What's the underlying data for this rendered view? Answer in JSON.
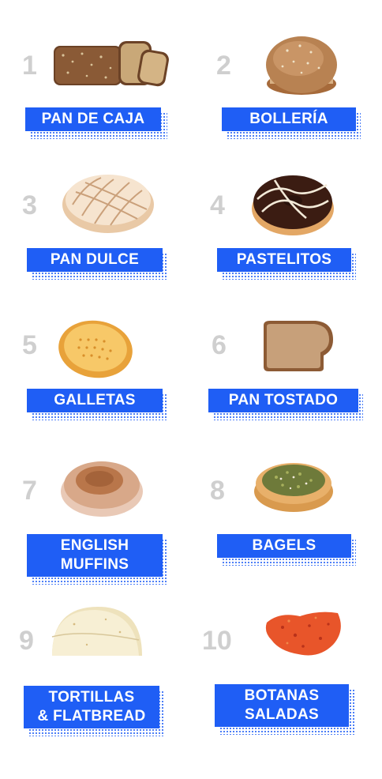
{
  "items": [
    {
      "number": "1",
      "label": "PAN DE CAJA",
      "image": "sliced-bread-loaf"
    },
    {
      "number": "2",
      "label": "BOLLERÍA",
      "image": "bun"
    },
    {
      "number": "3",
      "label": "PAN DULCE",
      "image": "concha-sweet-bread"
    },
    {
      "number": "4",
      "label": "PASTELITOS",
      "image": "chocolate-donut"
    },
    {
      "number": "5",
      "label": "GALLETAS",
      "image": "cookie"
    },
    {
      "number": "6",
      "label": "PAN TOSTADO",
      "image": "toast-slice"
    },
    {
      "number": "7",
      "label": "ENGLISH\nMUFFINS",
      "image": "english-muffin"
    },
    {
      "number": "8",
      "label": "BAGELS",
      "image": "bagel"
    },
    {
      "number": "9",
      "label": "TORTILLAS\n& FLATBREAD",
      "image": "tortillas"
    },
    {
      "number": "10",
      "label": "BOTANAS\nSALADAS",
      "image": "chip"
    }
  ],
  "colors": {
    "accent": "#1f5ef5",
    "number": "#cfcfcf",
    "background": "#ffffff"
  }
}
